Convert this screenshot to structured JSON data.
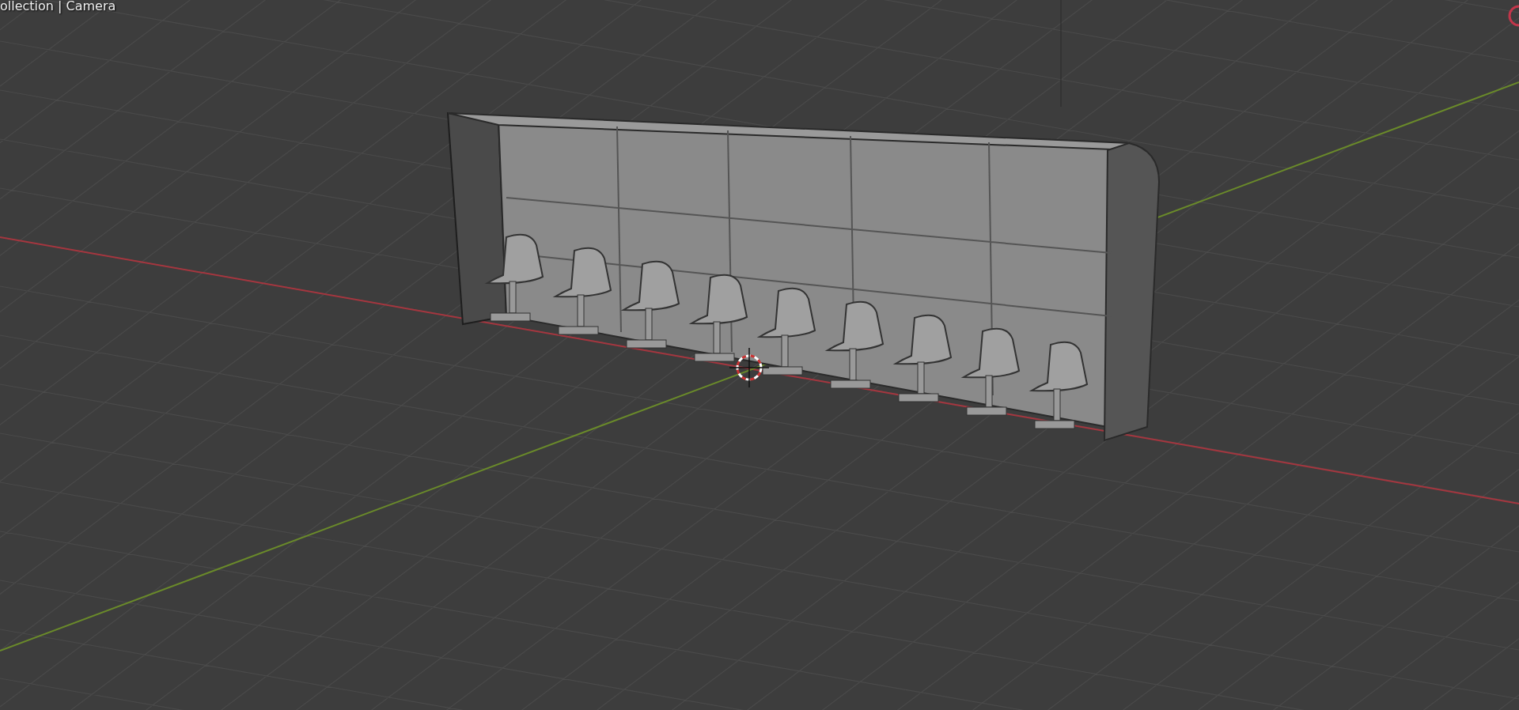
{
  "viewport": {
    "header_text": "ollection | Camera"
  }
}
